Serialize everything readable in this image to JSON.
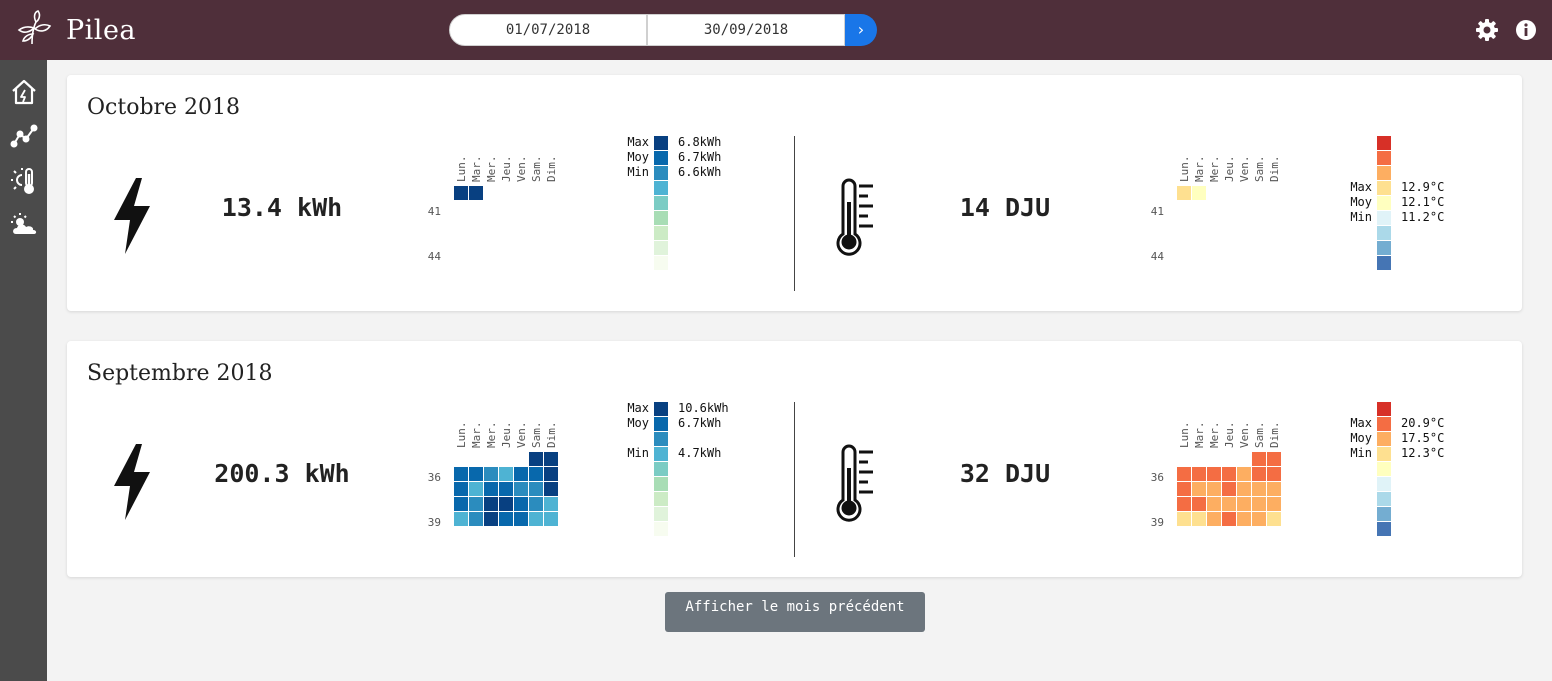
{
  "app": {
    "name": "Pilea"
  },
  "daterange": {
    "start": "01/07/2018",
    "end": "30/09/2018",
    "go_label": "›"
  },
  "colors": {
    "topbar": "#4f2f3a",
    "sidebar": "#4b4b4b",
    "accent": "#1976e8",
    "elec_scale": [
      "#f7fcf0",
      "#e0f3db",
      "#ccebc5",
      "#a8ddb5",
      "#7bccc4",
      "#4eb3d3",
      "#2b8cbe",
      "#0868ac",
      "#084081"
    ],
    "temp_scale": [
      "#4575b4",
      "#74add1",
      "#abd9e9",
      "#e0f3f8",
      "#ffffbf",
      "#fee090",
      "#fdae61",
      "#f46d43",
      "#d73027"
    ]
  },
  "sidebar": {
    "items": [
      {
        "name": "home-icon"
      },
      {
        "name": "chart-line-icon"
      },
      {
        "name": "thermometer-sun-icon"
      },
      {
        "name": "weather-icon"
      }
    ]
  },
  "weekdays": [
    "Lun.",
    "Mar.",
    "Mer.",
    "Jeu.",
    "Ven.",
    "Sam.",
    "Dim."
  ],
  "legend_labels": {
    "max": "Max",
    "avg": "Moy",
    "min": "Min"
  },
  "months": [
    {
      "title": "Octobre 2018",
      "elec": {
        "total": "13.4 kWh",
        "max": "6.8kWh",
        "avg": "6.7kWh",
        "min": "6.6kWh",
        "week_labels": [
          "41",
          "44"
        ],
        "days": [
          [
            0,
            0,
            8
          ],
          [
            0,
            1,
            8
          ]
        ]
      },
      "temp": {
        "total": "14 DJU",
        "max": "12.9°C",
        "avg": "12.1°C",
        "min": "11.2°C",
        "week_labels": [
          "41",
          "44"
        ],
        "days": [
          [
            0,
            0,
            5
          ],
          [
            0,
            1,
            4
          ]
        ]
      }
    },
    {
      "title": "Septembre 2018",
      "elec": {
        "total": "200.3 kWh",
        "max": "10.6kWh",
        "avg": "6.7kWh",
        "min": "4.7kWh",
        "week_labels": [
          "36",
          "39"
        ],
        "days": [
          [
            0,
            5,
            8
          ],
          [
            0,
            6,
            8
          ],
          [
            1,
            0,
            7
          ],
          [
            1,
            1,
            7
          ],
          [
            1,
            2,
            6
          ],
          [
            1,
            3,
            5
          ],
          [
            1,
            4,
            7
          ],
          [
            1,
            5,
            7
          ],
          [
            1,
            6,
            8
          ],
          [
            2,
            0,
            7
          ],
          [
            2,
            1,
            5
          ],
          [
            2,
            2,
            7
          ],
          [
            2,
            3,
            7
          ],
          [
            2,
            4,
            6
          ],
          [
            2,
            5,
            6
          ],
          [
            2,
            6,
            8
          ],
          [
            3,
            0,
            7
          ],
          [
            3,
            1,
            6
          ],
          [
            3,
            2,
            8
          ],
          [
            3,
            3,
            8
          ],
          [
            3,
            4,
            7
          ],
          [
            3,
            5,
            6
          ],
          [
            3,
            6,
            5
          ],
          [
            4,
            0,
            5
          ],
          [
            4,
            1,
            6
          ],
          [
            4,
            2,
            8
          ],
          [
            4,
            3,
            7
          ],
          [
            4,
            4,
            7
          ],
          [
            4,
            5,
            5
          ],
          [
            4,
            6,
            5
          ]
        ]
      },
      "temp": {
        "total": "32 DJU",
        "max": "20.9°C",
        "avg": "17.5°C",
        "min": "12.3°C",
        "week_labels": [
          "36",
          "39"
        ],
        "days": [
          [
            0,
            5,
            7
          ],
          [
            0,
            6,
            7
          ],
          [
            1,
            0,
            7
          ],
          [
            1,
            1,
            7
          ],
          [
            1,
            2,
            7
          ],
          [
            1,
            3,
            7
          ],
          [
            1,
            4,
            6
          ],
          [
            1,
            5,
            7
          ],
          [
            1,
            6,
            7
          ],
          [
            2,
            0,
            7
          ],
          [
            2,
            1,
            6
          ],
          [
            2,
            2,
            6
          ],
          [
            2,
            3,
            7
          ],
          [
            2,
            4,
            6
          ],
          [
            2,
            5,
            6
          ],
          [
            2,
            6,
            6
          ],
          [
            3,
            0,
            7
          ],
          [
            3,
            1,
            7
          ],
          [
            3,
            2,
            6
          ],
          [
            3,
            3,
            6
          ],
          [
            3,
            4,
            6
          ],
          [
            3,
            5,
            6
          ],
          [
            3,
            6,
            6
          ],
          [
            4,
            0,
            5
          ],
          [
            4,
            1,
            5
          ],
          [
            4,
            2,
            6
          ],
          [
            4,
            3,
            7
          ],
          [
            4,
            4,
            6
          ],
          [
            4,
            5,
            6
          ],
          [
            4,
            6,
            5
          ]
        ]
      }
    }
  ],
  "prev_button": "Afficher le mois précédent"
}
